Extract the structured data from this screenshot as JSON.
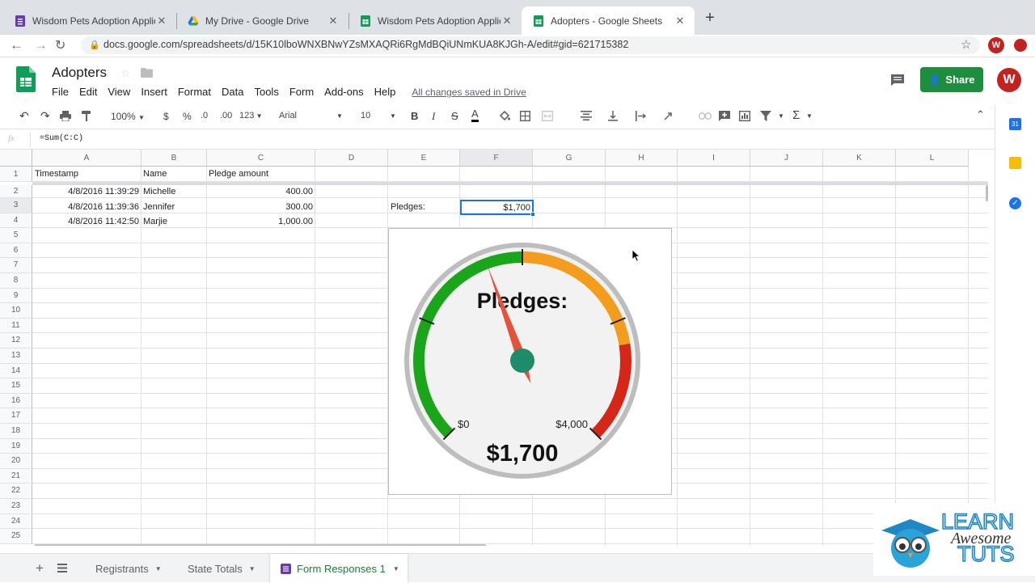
{
  "browser": {
    "tabs": [
      {
        "label": "Wisdom Pets Adoption Applica",
        "icon": "forms-icon",
        "active": false
      },
      {
        "label": "My Drive - Google Drive",
        "icon": "drive-icon",
        "active": false
      },
      {
        "label": "Wisdom Pets Adoption Applica",
        "icon": "sheets-icon",
        "active": false
      },
      {
        "label": "Adopters - Google Sheets",
        "icon": "sheets-icon",
        "active": true
      }
    ],
    "url": "docs.google.com/spreadsheets/d/15K10lboWNXBNwYZsMXAQRi6RgMdBQiUNmKUA8KJGh-A/edit#gid=621715382",
    "profile_initial": "W"
  },
  "app": {
    "doc_title": "Adopters",
    "menu": [
      "File",
      "Edit",
      "View",
      "Insert",
      "Format",
      "Data",
      "Tools",
      "Form",
      "Add-ons",
      "Help"
    ],
    "save_status": "All changes saved in Drive",
    "share_label": "Share",
    "user_initial": "W"
  },
  "toolbar": {
    "zoom": "100%",
    "currency": "$",
    "percent": "%",
    "dec_less": ".0",
    "dec_more": ".00",
    "format_more": "123",
    "font": "Arial",
    "font_size": "10",
    "bold": "B",
    "italic": "I",
    "strike": "S",
    "text_color": "A"
  },
  "formula_bar": {
    "fx": "fx",
    "formula": "=Sum(C:C)"
  },
  "grid": {
    "columns": [
      "A",
      "B",
      "C",
      "D",
      "E",
      "F",
      "G",
      "H",
      "I",
      "J",
      "K",
      "L"
    ],
    "rows": [
      "1",
      "2",
      "3",
      "4",
      "5",
      "6",
      "7",
      "8",
      "9",
      "10",
      "11",
      "12",
      "13",
      "14",
      "15",
      "16",
      "17",
      "18",
      "19",
      "20",
      "21",
      "22",
      "23",
      "24",
      "25"
    ],
    "headers": {
      "timestamp": "Timestamp",
      "name": "Name",
      "pledge": "Pledge amount"
    },
    "records": [
      {
        "timestamp": "4/8/2016 11:39:29",
        "name": "Michelle",
        "amount": "400.00"
      },
      {
        "timestamp": "4/8/2016 11:39:36",
        "name": "Jennifer",
        "amount": "300.00"
      },
      {
        "timestamp": "4/8/2016 11:42:50",
        "name": "Marjie",
        "amount": "1,000.00"
      }
    ],
    "pledges_label": "Pledges:",
    "pledges_value": "$1,700"
  },
  "gauge": {
    "title": "Pledges:",
    "value_label": "$1,700",
    "min_label": "$0",
    "max_label": "$4,000",
    "value": 1700,
    "min": 0,
    "max": 4000,
    "colors": {
      "green": "#1aa51a",
      "orange": "#f39c1e",
      "red": "#d62618",
      "needle": "#e8503a",
      "hub": "#1e8b6a"
    }
  },
  "sheets": {
    "tabs": [
      "Registrants",
      "State Totals",
      "Form Responses 1"
    ],
    "active": "Form Responses 1"
  },
  "watermark": {
    "line1": "LEARN",
    "line2": "Awesome",
    "line3": "TUTS"
  },
  "colors": {
    "sheets_green": "#0f9d58",
    "tab_strip": "#dee1e6",
    "selection_blue": "#1a73e8",
    "forms_purple": "#673ab7"
  }
}
